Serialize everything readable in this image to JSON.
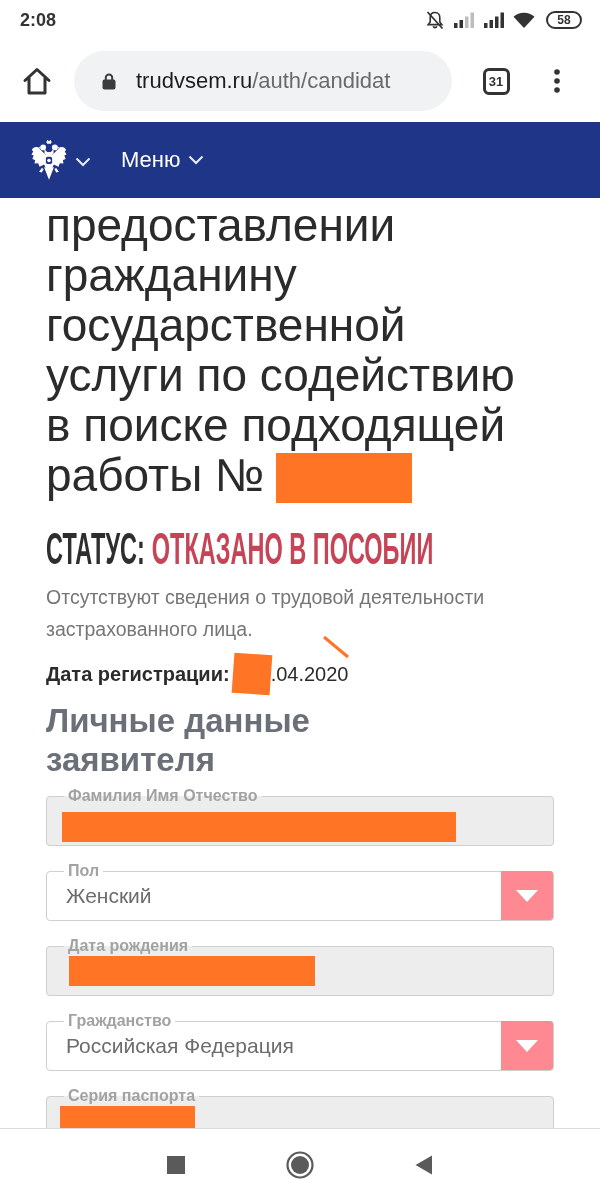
{
  "status_bar": {
    "time": "2:08",
    "battery": "58"
  },
  "browser": {
    "url_host": "trudvsem.ru",
    "url_path": "/auth/candidat",
    "tab_count": "31"
  },
  "header": {
    "menu_label": "Меню"
  },
  "document": {
    "title": "предоставлении гражданину государственной услуги по содействию в поиске подходящей работы №",
    "number_redacted": true,
    "status_label": "СТАТУС:",
    "status_value": "ОТКАЗАНО В ПОСОБИИ",
    "status_note": "Отсутствуют сведения о трудовой деятельности застрахованного лица.",
    "registration_label": "Дата регистрации:",
    "registration_redacted": true,
    "registration_date": ".04.2020"
  },
  "section": {
    "title": "Личные данные заявителя",
    "fields": [
      {
        "label": "Фамилия Имя Отчество",
        "kind": "text",
        "readonly": true,
        "redacted": true
      },
      {
        "label": "Пол",
        "kind": "select",
        "readonly": false,
        "redacted": false,
        "value": "Женский"
      },
      {
        "label": "Дата рождения",
        "kind": "text",
        "readonly": true,
        "redacted": true
      },
      {
        "label": "Гражданство",
        "kind": "select",
        "readonly": false,
        "redacted": false,
        "value": "Российская Федерация"
      },
      {
        "label": "Серия паспорта",
        "kind": "text",
        "readonly": true,
        "redacted": true
      }
    ]
  }
}
